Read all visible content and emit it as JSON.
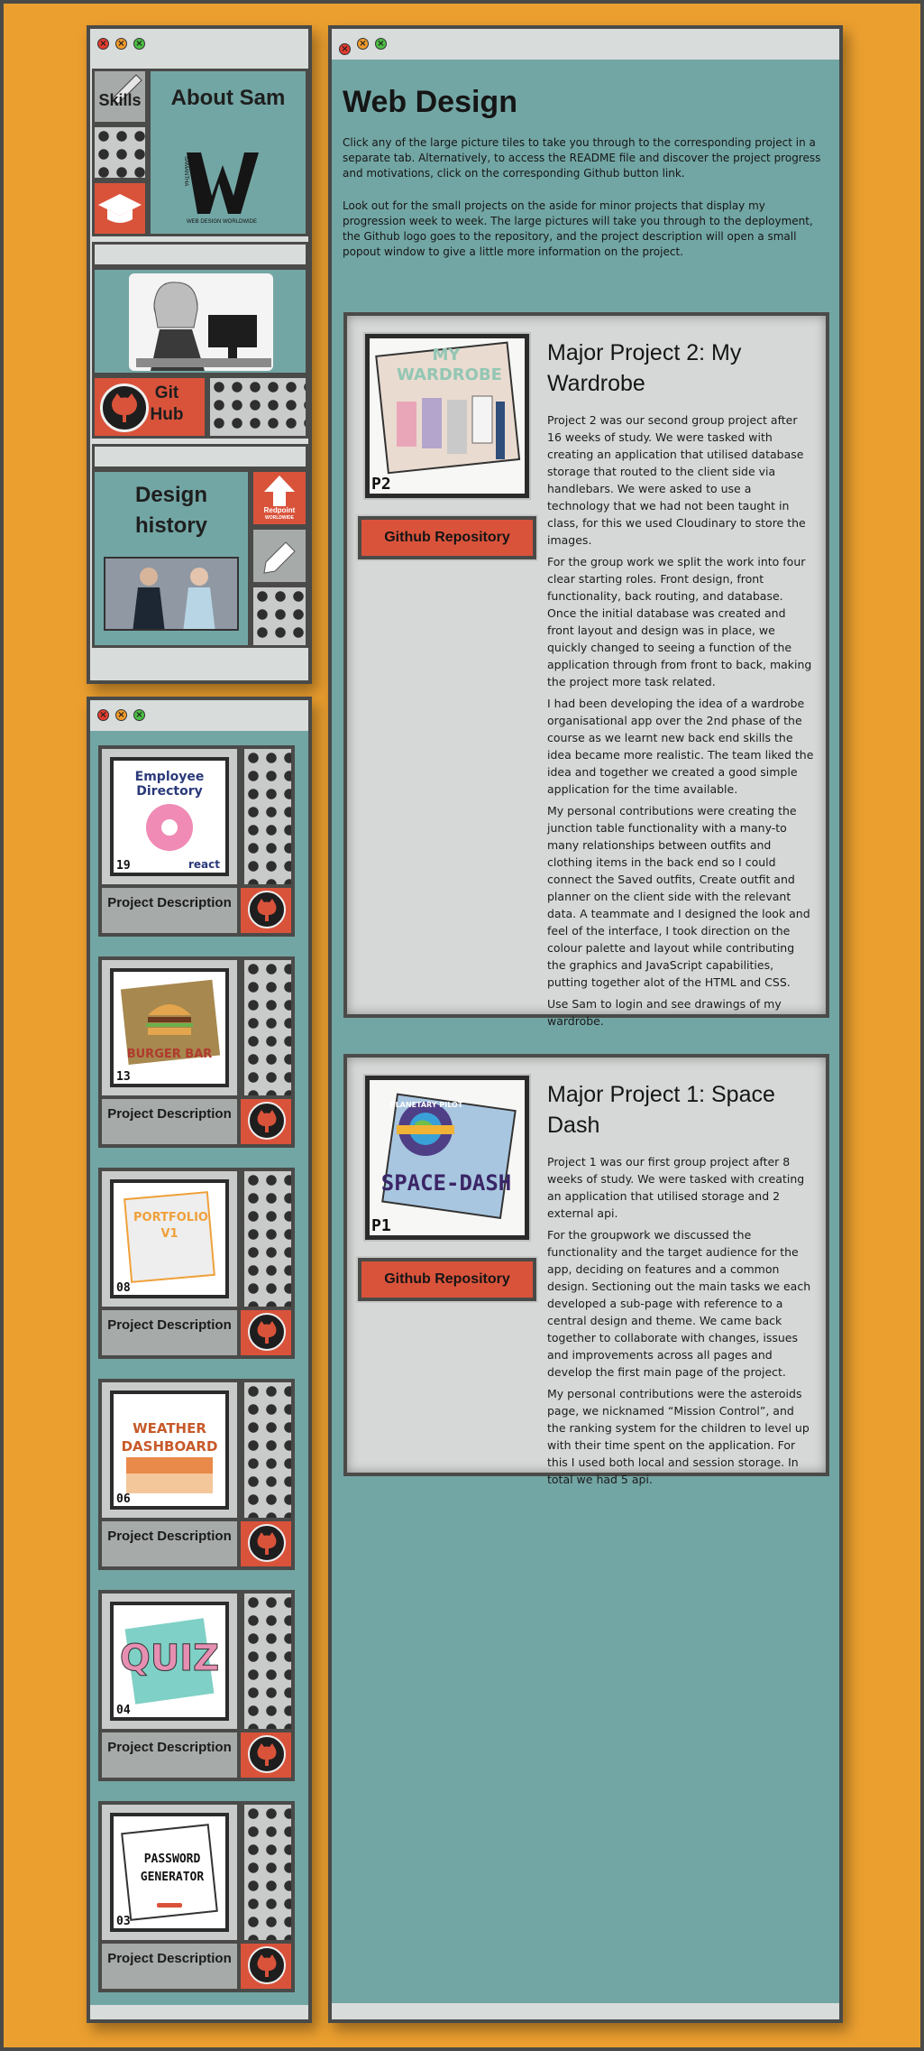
{
  "about_window": {
    "skills_label": "Skills",
    "about_title": "About Sam",
    "logo_side_text": "SAMANTHA",
    "logo_bottom_text": "WEB DESIGN WORLDWIDE",
    "github_label_1": "Git",
    "github_label_2": "Hub",
    "design_history_1": "Design",
    "design_history_2": "history",
    "redpoint_label": "Redpoint",
    "redpoint_sub": "WORLDWIDE"
  },
  "main": {
    "title": "Web Design",
    "intro_1": "Click any of the large picture tiles to take you through to the corresponding project in a separate tab. Alternatively, to access the README file and discover the project progress and motivations, click on the corresponding Github button link.",
    "intro_2": "Look out for the small projects on the aside for minor projects that display my progression week to week. The large pictures will take you through to the deployment, the Github logo goes to the repository, and the project description will open a small popout window to give a little more information on the project.",
    "projects": [
      {
        "title": "Major Project 2: My Wardrobe",
        "thumb_label": "MY WARDROBE",
        "number": "P2",
        "github_label": "Github Repository",
        "paragraphs": [
          "Project 2 was our second group project after 16 weeks of study. We were tasked with creating an application that utilised database storage that routed to the client side via handlebars. We were asked to use a technology that we had not been taught in class, for this we used Cloudinary to store the images.",
          "For the group work we split the work into four clear starting roles. Front design, front functionality, back routing, and database. Once the initial database was created and front layout and design was in place, we quickly changed to seeing a function of the application through from front to back, making the project more task related.",
          "I had been developing the idea of a wardrobe organisational app over the 2nd phase of the course as we learnt new back end skills the idea became more realistic. The team liked the idea and together we created a good simple application for the time available.",
          "My personal contributions were creating the junction table functionality with a many-to many relationships between outfits and clothing items in the back end so I could connect the Saved outfits, Create outfit and planner on the client side with the relevant data. A teammate and I designed the look and feel of the interface, I took direction on the colour palette and layout while contributing the graphics and JavaScript capabilities, putting together alot of the HTML and CSS.",
          "Use Sam to login and see drawings of my wardrobe."
        ]
      },
      {
        "title": "Major Project 1: Space Dash",
        "thumb_label_top": "PLANETARY PILOT",
        "thumb_label": "SPACE-DASH",
        "number": "P1",
        "github_label": "Github Repository",
        "paragraphs": [
          "Project 1 was our first group project after 8 weeks of study. We were tasked with creating an application that utilised storage and 2 external api.",
          "For the groupwork we discussed the functionality and the target audience for the app, deciding on features and a common design. Sectioning out the main tasks we each developed a sub-page with reference to a central design and theme. We came back together to collaborate with changes, issues and improvements across all pages and develop the first main page of the project.",
          "My personal contributions were the asteroids page, we nicknamed “Mission Control”, and the ranking system for the children to level up with their time spent on the application. For this I used both local and session storage. In total we had 5 api."
        ]
      }
    ]
  },
  "sidebar_cards": [
    {
      "thumb_label": "Employee Directory",
      "thumb_sub": "react",
      "number": "19",
      "desc": "Project Description"
    },
    {
      "thumb_label": "BURGER BAR",
      "number": "13",
      "desc": "Project Description"
    },
    {
      "thumb_label": "PORTFOLIO V1",
      "number": "08",
      "desc": "Project Description"
    },
    {
      "thumb_label": "WEATHER DASHBOARD",
      "number": "06",
      "desc": "Project Description"
    },
    {
      "thumb_label": "QUIZ",
      "number": "04",
      "desc": "Project Description"
    },
    {
      "thumb_label": "PASSWORD GENERATOR",
      "number": "03",
      "desc": "Project Description"
    }
  ],
  "colors": {
    "background": "#eb9f2f",
    "teal": "#72a6a4",
    "accent_red": "#d9533b",
    "window_grey": "#d8dcdb",
    "border": "#4a4a48"
  }
}
